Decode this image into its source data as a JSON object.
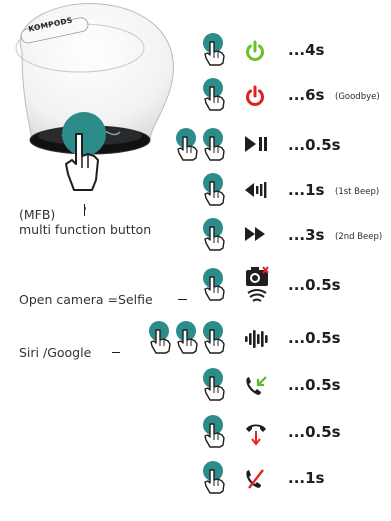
{
  "brand": "KOMPODS",
  "colors": {
    "finger_teal": "#2b8c8a",
    "power_on": "#6cbf2e",
    "power_off": "#e01f1f",
    "answer_arrow": "#5cb82e",
    "hangup_arrow": "#e0281f",
    "dark": "#1f1f1f"
  },
  "labels": {
    "mfb_abbr": "(MFB)",
    "mfb_full": "multi function button",
    "camera": "Open camera =Selfie",
    "siri": "Siri /Google"
  },
  "rows": [
    {
      "icon": "power-on-icon",
      "taps": 1,
      "duration": "...4s",
      "note": ""
    },
    {
      "icon": "power-off-icon",
      "taps": 1,
      "duration": "...6s",
      "note": "(Goodbye)"
    },
    {
      "icon": "play-pause-icon",
      "taps": 2,
      "duration": "...0.5s",
      "note": ""
    },
    {
      "icon": "previous-track-icon",
      "taps": 1,
      "duration": "...1s",
      "note": "(1st Beep)"
    },
    {
      "icon": "next-track-icon",
      "taps": 1,
      "duration": "...3s",
      "note": "(2nd Beep)"
    },
    {
      "icon": "camera-icon",
      "taps": 1,
      "duration": "...0.5s",
      "note": ""
    },
    {
      "icon": "voice-assistant-icon",
      "taps": 3,
      "duration": "...0.5s",
      "note": ""
    },
    {
      "icon": "answer-call-icon",
      "taps": 1,
      "duration": "...0.5s",
      "note": ""
    },
    {
      "icon": "hang-up-icon",
      "taps": 1,
      "duration": "...0.5s",
      "note": ""
    },
    {
      "icon": "reject-call-icon",
      "taps": 1,
      "duration": "...1s",
      "note": ""
    }
  ]
}
